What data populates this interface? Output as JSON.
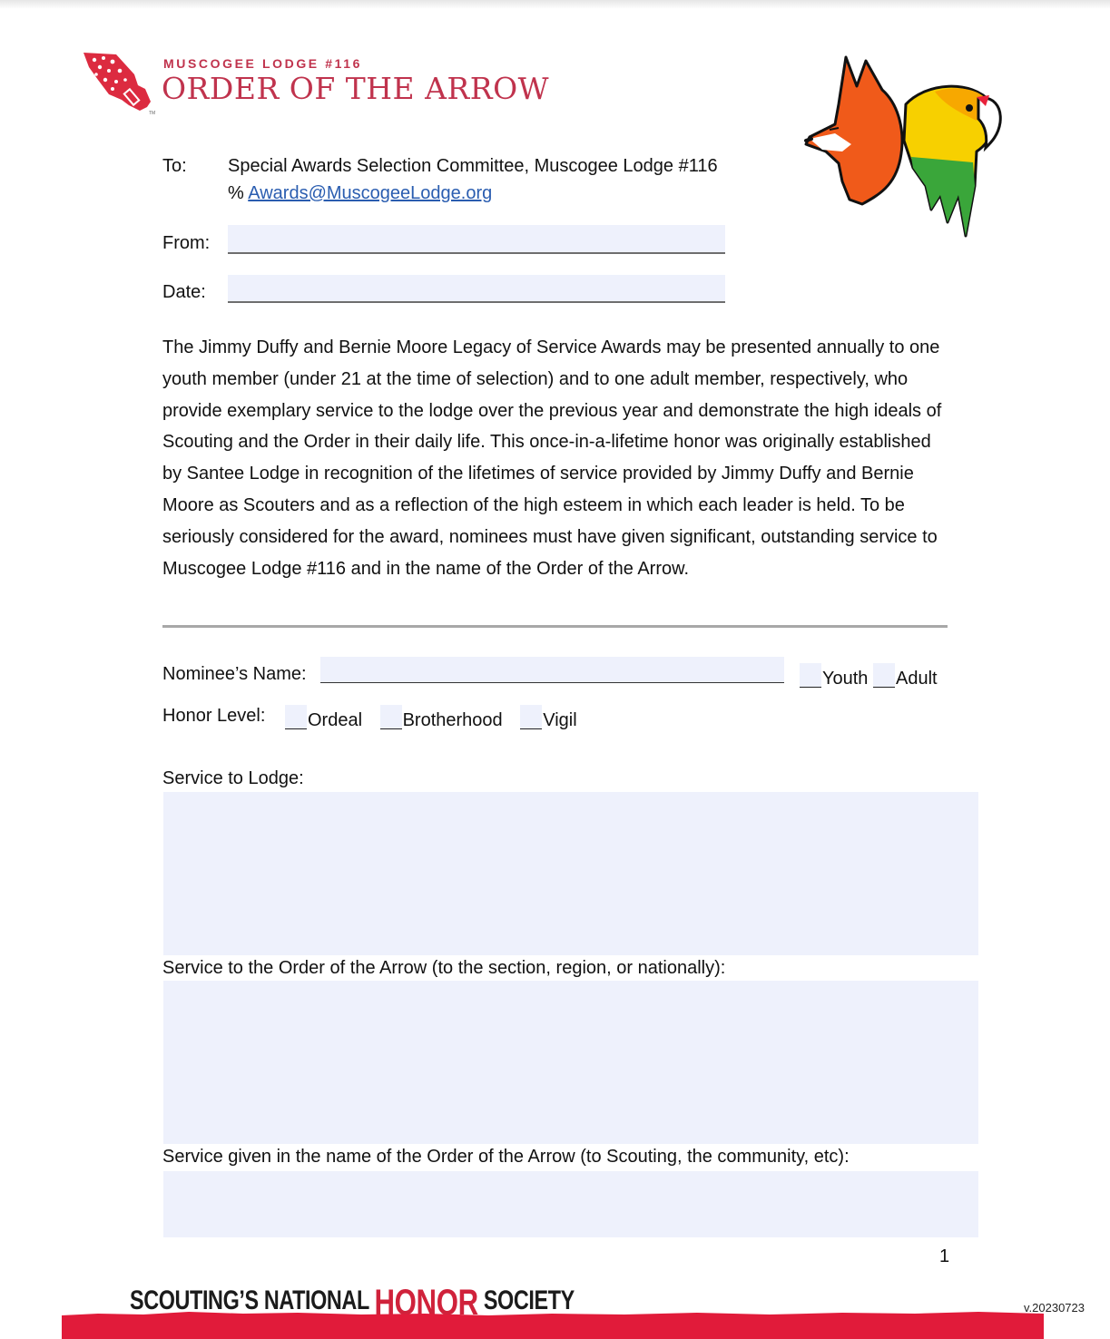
{
  "header": {
    "lodge_name": "MUSCOGEE LODGE #116",
    "org_title": "ORDER OF THE ARROW",
    "trademark": "TM",
    "brand_color": "#c0334d",
    "mascot_icon": "fox-and-parakeet-mascot"
  },
  "memo": {
    "to_label": "To:",
    "to_value": "Special Awards Selection Committee, Muscogee Lodge #116",
    "care_of_symbol": "%",
    "email": "Awards@MuscogeeLodge.org",
    "from_label": "From:",
    "from_value": "",
    "date_label": "Date:",
    "date_value": ""
  },
  "intro_paragraph": "The Jimmy Duffy and Bernie Moore Legacy of Service Awards may be presented annually to one youth member (under 21 at the time of selection) and to one adult member, respectively, who provide exemplary service to the lodge over the previous year and demonstrate the high ideals of Scouting and the Order in their daily life. This once-in-a-lifetime honor was originally established by Santee Lodge in recognition of the lifetimes of service provided by Jimmy Duffy and Bernie Moore as Scouters and as a reflection of the high esteem in which each leader is held. To be seriously considered for the award, nominees must have given significant, outstanding service to Muscogee Lodge #116 and in the name of the Order of the Arrow.",
  "nominee": {
    "name_label": "Nominee’s Name:",
    "name_value": "",
    "type_options": [
      {
        "label": "Youth",
        "checked": false
      },
      {
        "label": "Adult",
        "checked": false
      }
    ],
    "honor_label": "Honor Level:",
    "honor_options": [
      {
        "label": "Ordeal",
        "checked": false
      },
      {
        "label": "Brotherhood",
        "checked": false
      },
      {
        "label": "Vigil",
        "checked": false
      }
    ]
  },
  "sections": [
    {
      "label": "Service to Lodge:",
      "value": ""
    },
    {
      "label": "Service to the Order of the Arrow (to the section, region, or nationally):",
      "value": ""
    },
    {
      "label": "Service given in the name of the Order of the Arrow (to Scouting, the community, etc):",
      "value": ""
    }
  ],
  "footer": {
    "page_number": "1",
    "tagline_part1": "SCOUTING’S NATIONAL ",
    "tagline_highlight": "HONOR",
    "tagline_part2": " SOCIETY",
    "version": "v.20230723",
    "band_color": "#e11b3a"
  }
}
